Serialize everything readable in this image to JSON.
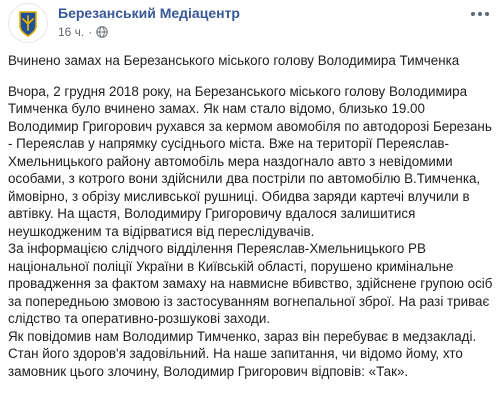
{
  "header": {
    "page_name": "Березанський Медіацентр",
    "timestamp": "16 ч.",
    "separator": "·",
    "more_icon": "more-horizontal-icon",
    "audience_icon": "globe-icon",
    "brand_color": "#385898"
  },
  "post": {
    "title": "Вчинено замах на Березанського міського голову Володимира Тимченка",
    "paragraphs": [
      "Вчора, 2 грудня 2018 року, на Березанського міського голову Володимира Тимченка було вчинено замах. Як нам стало відомо, близько 19.00 Володимир Григорович рухався за кермом авомобіля по автодорозі Березань - Переяслав у напрямку сусіднього міста. Вже на території Переяслав-Хмельницького району автомобіль мера наздогнало авто з невідомими особами, з котрого вони здійснили два постріли по автомобілю В.Тимченка, ймовірно, з обрізу мисливської рушниці. Обидва заряди картечі влучили в автівку. На щастя, Володимиру Григоровичу вдалося залишитися неушкодженим та відірватися від переслідувачів.",
      "За інформацією слідчого відділення Переяслав-Хмельницького РВ національної поліції України в Київській області, порушено кримінальне провадження за фактом замаху на навмисне вбивство, здійснене групою осіб за попередньою змовою із застосуванням вогнепальної зброї. На разі триває слідство та оперативно-розшукові заходи.",
      "Як повідомив нам Володимир Тимченко, зараз він перебуває в медзакладі. Стан його здоров'я задовільний. На наше запитання, чи відомо йому, хто замовник цього злочину, Володимир Григорович відповів: «Так»."
    ]
  }
}
